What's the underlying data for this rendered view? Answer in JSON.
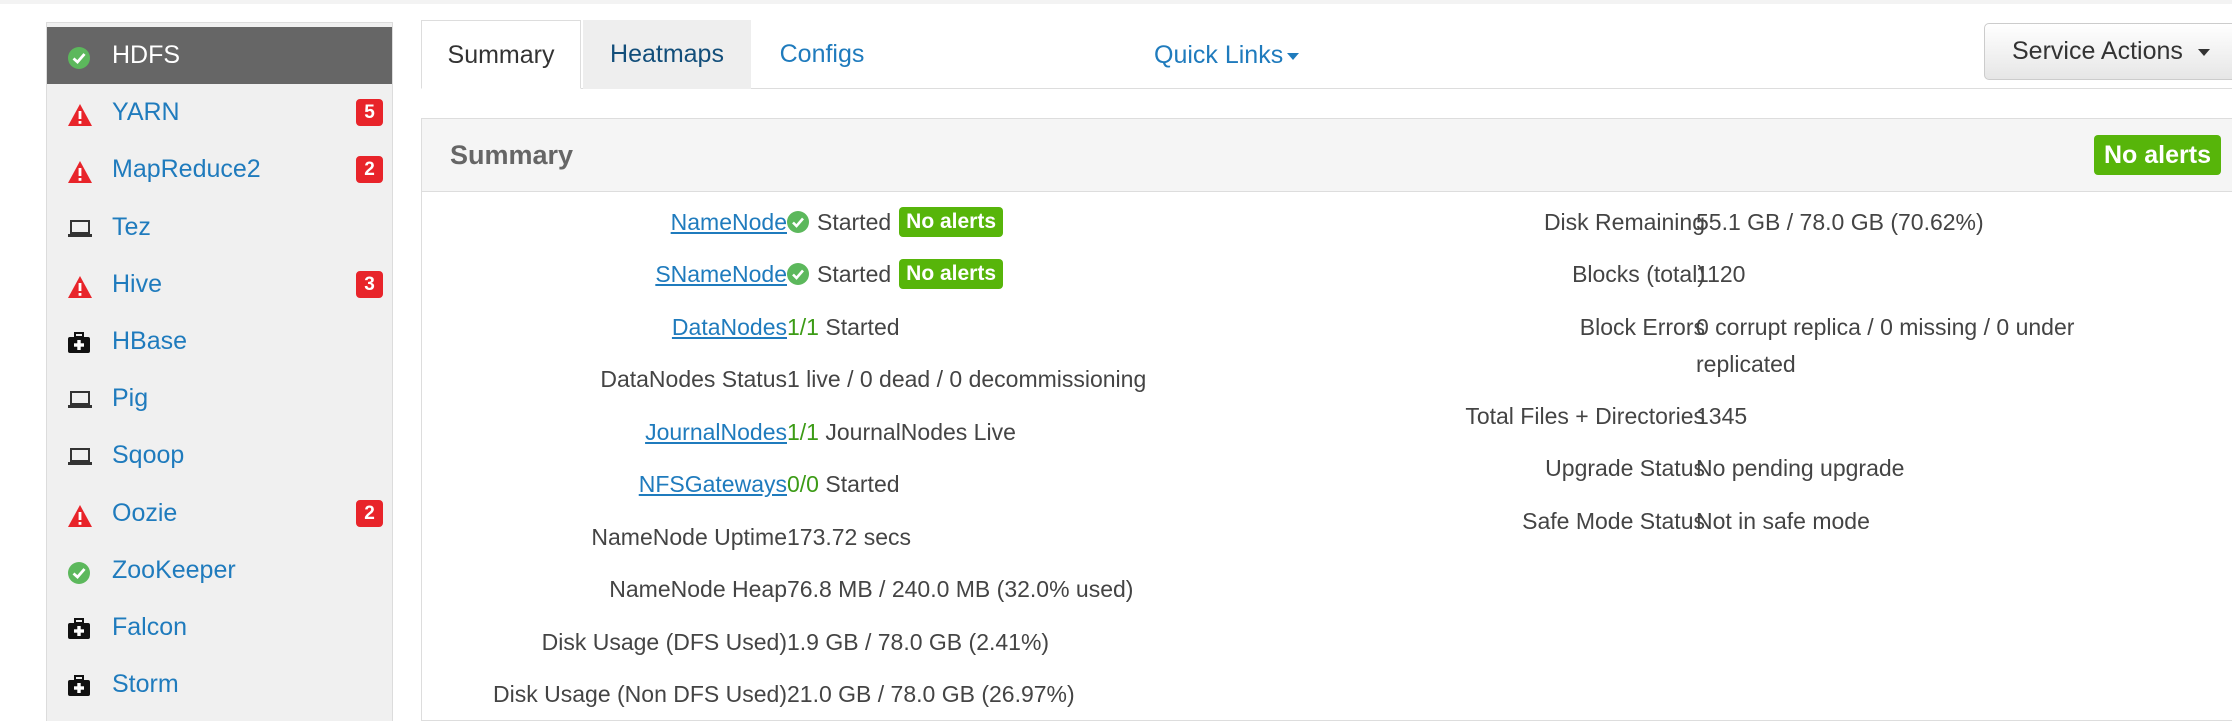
{
  "sidebar": {
    "items": [
      {
        "label": "HDFS",
        "icon": "check-circle-icon",
        "badge": null
      },
      {
        "label": "YARN",
        "icon": "warning-icon",
        "badge": "5"
      },
      {
        "label": "MapReduce2",
        "icon": "warning-icon",
        "badge": "2"
      },
      {
        "label": "Tez",
        "icon": "laptop-icon",
        "badge": null
      },
      {
        "label": "Hive",
        "icon": "warning-icon",
        "badge": "3"
      },
      {
        "label": "HBase",
        "icon": "medkit-icon",
        "badge": null
      },
      {
        "label": "Pig",
        "icon": "laptop-icon",
        "badge": null
      },
      {
        "label": "Sqoop",
        "icon": "laptop-icon",
        "badge": null
      },
      {
        "label": "Oozie",
        "icon": "warning-icon",
        "badge": "2"
      },
      {
        "label": "ZooKeeper",
        "icon": "check-circle-icon",
        "badge": null
      },
      {
        "label": "Falcon",
        "icon": "medkit-icon",
        "badge": null
      },
      {
        "label": "Storm",
        "icon": "medkit-icon",
        "badge": null
      }
    ]
  },
  "tabs": {
    "summary": "Summary",
    "heatmaps": "Heatmaps",
    "configs": "Configs"
  },
  "quick_links": "Quick Links",
  "service_actions": "Service Actions",
  "summary": {
    "title": "Summary",
    "header_alert": "No alerts",
    "namenode": {
      "label": "NameNode",
      "status": "Started",
      "alert": "No alerts"
    },
    "snamenode": {
      "label": "SNameNode",
      "status": "Started",
      "alert": "No alerts"
    },
    "datanodes": {
      "label": "DataNodes",
      "count": "1/1",
      "status": "Started"
    },
    "datanodes_status": {
      "label": "DataNodes Status",
      "value": "1 live / 0 dead / 0 decommissioning"
    },
    "journalnodes": {
      "label": "JournalNodes",
      "count": "1/1",
      "status": "JournalNodes Live"
    },
    "nfsgateways": {
      "label": "NFSGateways",
      "count": "0/0",
      "status": "Started"
    },
    "namenode_uptime": {
      "label": "NameNode Uptime",
      "value": "173.72 secs"
    },
    "namenode_heap": {
      "label": "NameNode Heap",
      "value": "76.8 MB / 240.0 MB (32.0% used)"
    },
    "disk_usage_dfs": {
      "label": "Disk Usage (DFS Used)",
      "value": "1.9 GB / 78.0 GB (2.41%)"
    },
    "disk_usage_non_dfs": {
      "label": "Disk Usage (Non DFS Used)",
      "value": "21.0 GB / 78.0 GB (26.97%)"
    },
    "disk_remaining": {
      "label": "Disk Remaining",
      "value": "55.1 GB / 78.0 GB (70.62%)"
    },
    "blocks_total": {
      "label": "Blocks (total)",
      "value": "1120"
    },
    "block_errors": {
      "label": "Block Errors",
      "value_line1": "0 corrupt replica / 0 missing / 0 under",
      "value_line2": "replicated"
    },
    "total_files": {
      "label": "Total Files + Directories",
      "value": "1345"
    },
    "upgrade_status": {
      "label": "Upgrade Status",
      "value": "No pending upgrade"
    },
    "safe_mode": {
      "label": "Safe Mode Status",
      "value": "Not in safe mode"
    }
  },
  "colors": {
    "link": "#1f7bbd",
    "alert_green": "#57b50a",
    "badge_red": "#e8242a",
    "active_sidebar": "#666666"
  }
}
